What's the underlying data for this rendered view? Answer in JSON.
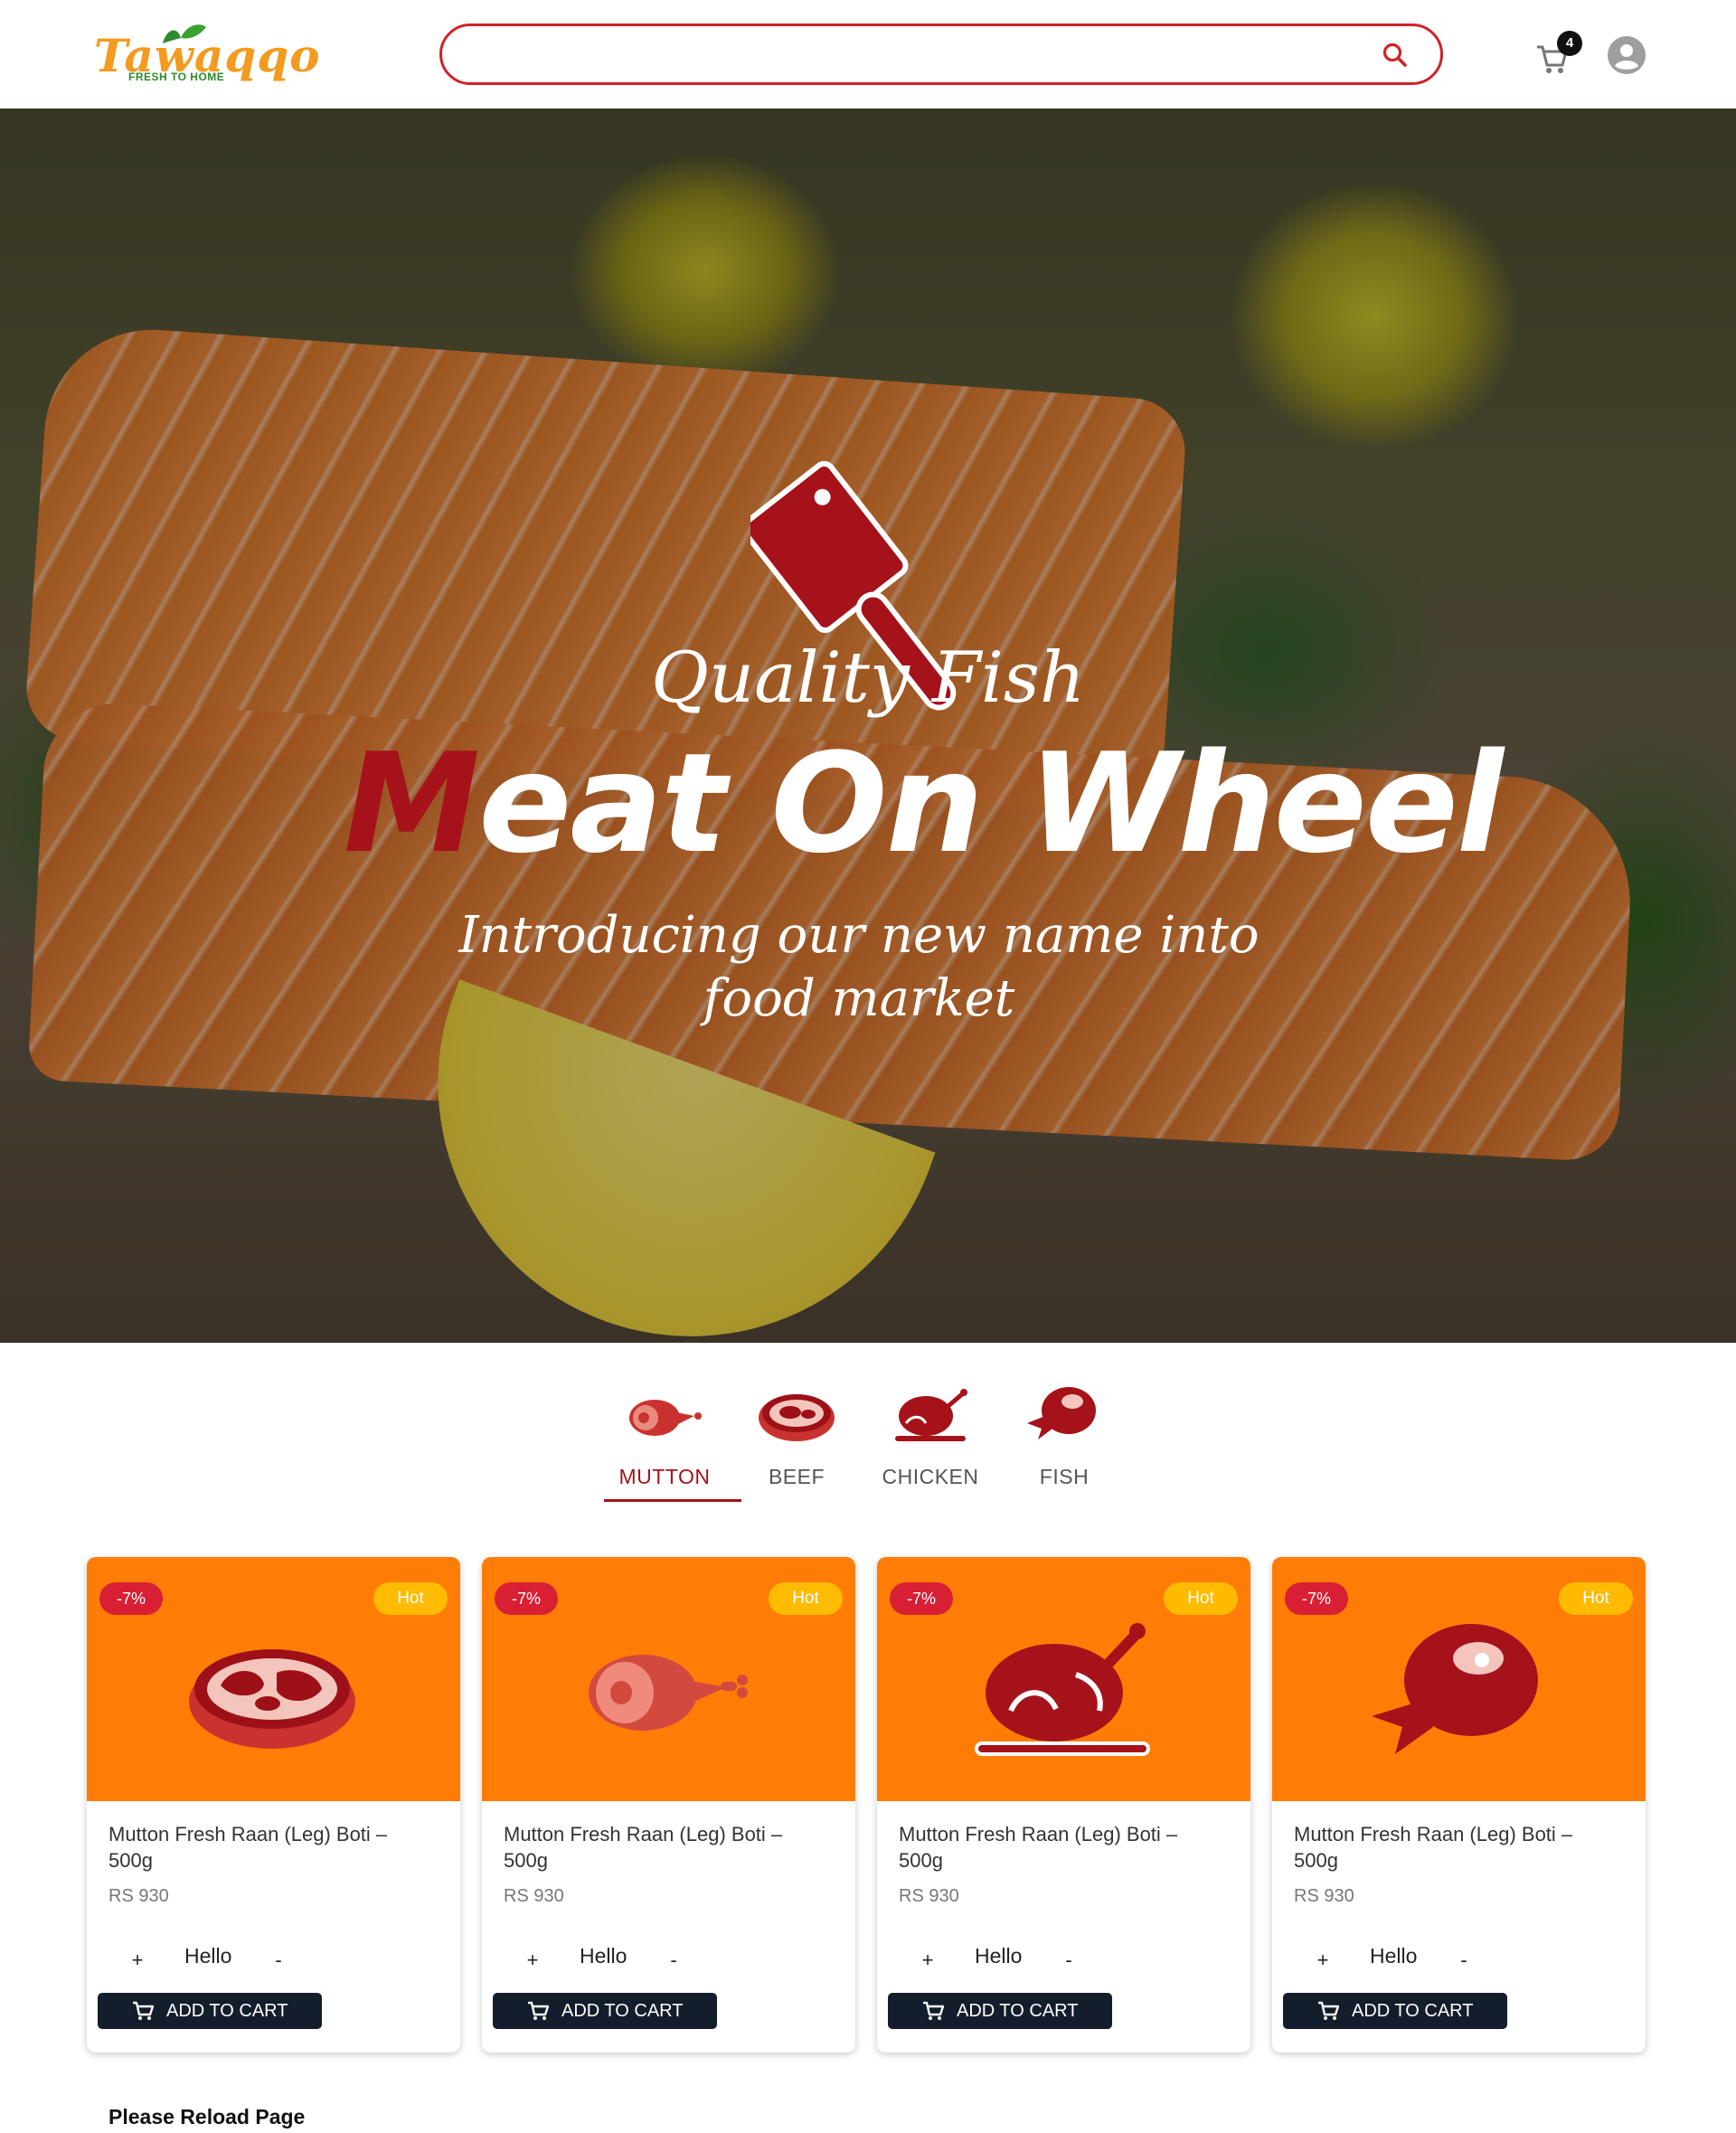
{
  "header": {
    "logo_text": "Tawaqqo",
    "logo_tagline": "FRESH TO HOME",
    "search_placeholder": "",
    "cart_count": "4",
    "icons": {
      "search": "search-icon",
      "cart": "cart-icon",
      "account": "account-circle-icon"
    }
  },
  "hero": {
    "tagline": "Quality Fish",
    "title_accent": "M",
    "title_rest": "eat On Wheel",
    "subtitle": "Introducing our new name into food market",
    "icon": "cleaver-icon"
  },
  "categories": [
    {
      "label": "MUTTON",
      "icon": "mutton-leg-icon",
      "active": true
    },
    {
      "label": "BEEF",
      "icon": "steak-icon",
      "active": false
    },
    {
      "label": "CHICKEN",
      "icon": "roast-chicken-icon",
      "active": false
    },
    {
      "label": "FISH",
      "icon": "fish-meat-icon",
      "active": false
    }
  ],
  "products": [
    {
      "discount": "-7%",
      "tag": "Hot",
      "name": "Mutton Fresh Raan (Leg) Boti – 500g",
      "price": "RS 930",
      "qty_plus": "+",
      "qty_label": "Hello",
      "qty_minus": "-",
      "button": "ADD TO CART",
      "icon": "steak-icon"
    },
    {
      "discount": "-7%",
      "tag": "Hot",
      "name": "Mutton Fresh Raan (Leg) Boti – 500g",
      "price": "RS 930",
      "qty_plus": "+",
      "qty_label": "Hello",
      "qty_minus": "-",
      "button": "ADD TO CART",
      "icon": "mutton-leg-icon"
    },
    {
      "discount": "-7%",
      "tag": "Hot",
      "name": "Mutton Fresh Raan (Leg) Boti – 500g",
      "price": "RS 930",
      "qty_plus": "+",
      "qty_label": "Hello",
      "qty_minus": "-",
      "button": "ADD TO CART",
      "icon": "roast-chicken-icon"
    },
    {
      "discount": "-7%",
      "tag": "Hot",
      "name": "Mutton Fresh Raan (Leg) Boti – 500g",
      "price": "RS 930",
      "qty_plus": "+",
      "qty_label": "Hello",
      "qty_minus": "-",
      "button": "ADD TO CART",
      "icon": "fish-meat-icon"
    }
  ],
  "footer_note": "Please Reload Page",
  "colors": {
    "brand_red": "#a5121a",
    "search_border": "#d0232a",
    "card_bg": "#ff7d06",
    "hot_badge": "#ffbb00",
    "discount_badge": "#d81f34",
    "button_dark": "#141d2b",
    "logo_orange": "#f39a1f"
  }
}
